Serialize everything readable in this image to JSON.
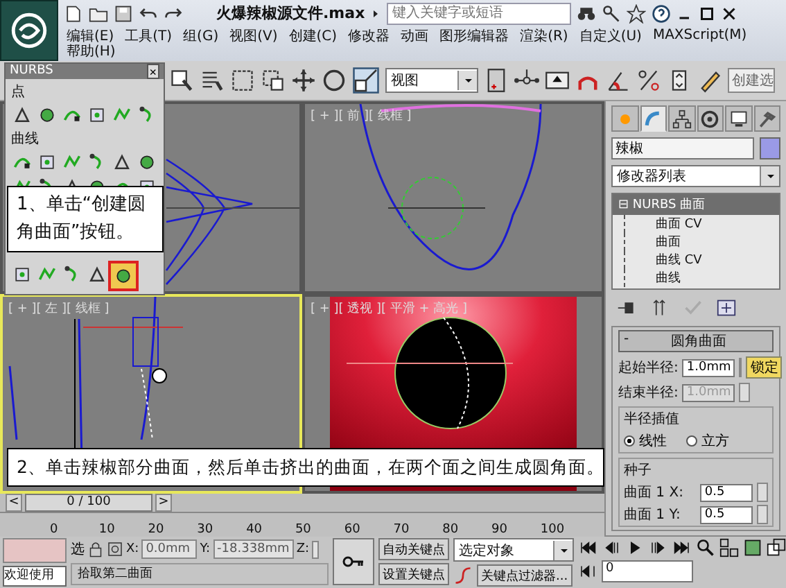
{
  "window": {
    "title": "火爆辣椒源文件.max",
    "search": {
      "placeholder": "键入关键字或短语"
    }
  },
  "menu": [
    "编辑(E)",
    "工具(T)",
    "组(G)",
    "视图(V)",
    "创建(C)",
    "修改器",
    "动画",
    "图形编辑器",
    "渲染(R)",
    "自定义(U)",
    "MAXScript(M)",
    "帮助(H)"
  ],
  "toolbar": {
    "view_dropdown": "视图",
    "selection_set": "创建选"
  },
  "nurbs_panel": {
    "title": "NURBS",
    "close": "×",
    "point_label": "点",
    "curve_label": "曲线",
    "last_row": [
      {
        "selected": false
      },
      {
        "selected": false
      },
      {
        "selected": false
      },
      {
        "selected": false
      },
      {
        "selected": true
      }
    ]
  },
  "viewports": [
    {
      "label": "[ + ][ 前 ][ 线框 ]",
      "kind": "front",
      "active": false
    },
    {
      "label": "[ + ][ 左 ][ 线框 ]",
      "kind": "left",
      "active": true
    },
    {
      "label": "[ + ][ 透视 ][ 平滑 + 高光 ]",
      "kind": "perspective",
      "active": false
    }
  ],
  "command_panel": {
    "tabs": [
      {
        "selected": false
      },
      {
        "selected": true
      },
      {
        "selected": false
      },
      {
        "selected": false
      },
      {
        "selected": false
      },
      {
        "selected": false
      }
    ],
    "object_name": "辣椒",
    "color": "#9a9ae6",
    "modifier_list": "修改器列表",
    "stack": [
      {
        "label": "NURBS 曲面",
        "toggle": "⊟",
        "selected": true,
        "children": [
          {
            "label": "曲面 CV",
            "selected": false
          },
          {
            "label": "曲面",
            "selected": false
          },
          {
            "label": "曲线 CV",
            "selected": false
          },
          {
            "label": "曲线",
            "selected": false
          }
        ]
      }
    ],
    "rollout": {
      "title": "圆角曲面",
      "collapse": "-",
      "start_radius": {
        "label": "起始半径:",
        "value": "1.0mm",
        "disabled": false
      },
      "end_radius": {
        "label": "结束半径:",
        "value": "1.0mm",
        "disabled": true
      },
      "lock": {
        "label": "锁定",
        "on": true
      },
      "interp_group": "半径插值",
      "interp": [
        {
          "label": "线性",
          "selected": true
        },
        {
          "label": "立方",
          "selected": false
        }
      ],
      "seed_group": "种子",
      "seeds": [
        {
          "label": "曲面 1 X:",
          "value": "0.5"
        },
        {
          "label": "曲面 1 Y:",
          "value": "0.5"
        }
      ]
    }
  },
  "time_slider": {
    "label": "0 / 100",
    "prev": "<",
    "next": ">"
  },
  "ruler": [
    "0",
    "10",
    "20",
    "30",
    "40",
    "50",
    "60",
    "70",
    "80",
    "90",
    "100"
  ],
  "status": {
    "welcome": "欢迎使用",
    "select": "选",
    "x": {
      "label": "X:",
      "value": "0.0mm"
    },
    "y": {
      "label": "Y:",
      "value": "-18.338mm"
    },
    "z": {
      "label": "Z:"
    },
    "prompt": "拾取第二曲面",
    "auto_key": "自动关键点",
    "set_key": "设置关键点",
    "key_mode": "选定对象",
    "key_filters": "关键点过滤器...",
    "frame": "0"
  },
  "callouts": [
    "1、单击“创建圆角曲面”按钮。",
    "2、单击辣椒部分曲面，然后单击挤出的曲面，在两个面之间生成圆角面。"
  ]
}
